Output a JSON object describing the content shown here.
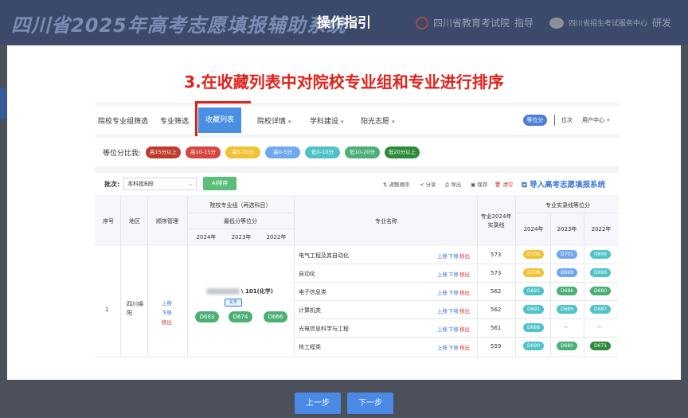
{
  "background": {
    "site_title": "四川省2025年高考志愿填报辅助系统",
    "partner1": "四川省教育考试院",
    "partner1_suffix": "指导",
    "partner2": "四川省招生考试服务中心",
    "partner2_suffix": "研发"
  },
  "modal": {
    "title": "操作指引",
    "step_heading": "3.在收藏列表中对院校专业组和专业进行排序",
    "prev_label": "上一步",
    "next_label": "下一步"
  },
  "nav": {
    "items": [
      "院校专业组筛选",
      "专业筛选",
      "收藏列表",
      "院校详情",
      "学科建设",
      "阳光志愿"
    ],
    "active_index": 2,
    "rank_pill": "等位分",
    "rank_text": "位次",
    "user_center": "用户中心"
  },
  "ratio": {
    "label": "等位分比我:",
    "pills": [
      {
        "text": "高15分以上",
        "color": "#c0392b"
      },
      {
        "text": "高10-15分",
        "color": "#d64541"
      },
      {
        "text": "高5-10分",
        "color": "#f1c232"
      },
      {
        "text": "高0-5分",
        "color": "#6fa8ee"
      },
      {
        "text": "低0-10分",
        "color": "#4fc3c9"
      },
      {
        "text": "低10-20分",
        "color": "#4caf76"
      },
      {
        "text": "低20分以上",
        "color": "#2e8b3a"
      }
    ]
  },
  "toolbar": {
    "batch_label": "批次:",
    "batch_value": "本科批B段",
    "ai_button": "AI排序",
    "tools": [
      "调整顺序",
      "分享",
      "导出",
      "保存",
      "清空"
    ],
    "import_label": "导入高考志愿填报系统"
  },
  "table": {
    "header": {
      "seq": "序号",
      "region": "地区",
      "order_mgmt": "顺序管理",
      "group": "院校专业组（再选科目）",
      "min_rank": "最低分等位分",
      "years": [
        "2024年",
        "2023年",
        "2022年"
      ],
      "major_name": "专业名称",
      "major_line": "专业2024年实录线",
      "major_rank": "专业实录线等位分"
    },
    "row": {
      "seq": "1",
      "region": "四川绵阳",
      "moves": [
        "上移",
        "下移",
        "移出"
      ],
      "group_code": "\\ 101(化学)",
      "subject_tag": "化学",
      "min_ranks": [
        "D683",
        "D674",
        "D666"
      ],
      "majors": [
        {
          "name": "电气工程及其自动化",
          "line": "573",
          "ranks": [
            {
              "t": "D706",
              "c": "#f1c232"
            },
            {
              "t": "D701",
              "c": "#6fa8ee"
            },
            {
              "t": "D696",
              "c": "#4fc3c9"
            }
          ]
        },
        {
          "name": "自动化",
          "line": "573",
          "ranks": [
            {
              "t": "D706",
              "c": "#f1c232"
            },
            {
              "t": "D699",
              "c": "#6fa8ee"
            },
            {
              "t": "D696",
              "c": "#4fc3c9"
            }
          ]
        },
        {
          "name": "电子信息类",
          "line": "562",
          "ranks": [
            {
              "t": "D692",
              "c": "#4fc3c9"
            },
            {
              "t": "D686",
              "c": "#4caf76"
            },
            {
              "t": "D680",
              "c": "#4caf76"
            }
          ]
        },
        {
          "name": "计算机类",
          "line": "562",
          "ranks": [
            {
              "t": "D691",
              "c": "#4fc3c9"
            },
            {
              "t": "D689",
              "c": "#4fc3c9"
            },
            {
              "t": "D687",
              "c": "#4fc3c9"
            }
          ]
        },
        {
          "name": "光电信息科学与工程",
          "line": "561",
          "ranks": [
            {
              "t": "D688",
              "c": "#4fc3c9"
            },
            {
              "t": "--",
              "c": ""
            },
            {
              "t": "--",
              "c": ""
            }
          ]
        },
        {
          "name": "核工程类",
          "line": "559",
          "ranks": [
            {
              "t": "D690",
              "c": "#4fc3c9"
            },
            {
              "t": "D680",
              "c": "#4caf76"
            },
            {
              "t": "D671",
              "c": "#2e8b3a"
            }
          ]
        }
      ],
      "major_moves": [
        "上移",
        "下移",
        "移出"
      ]
    }
  }
}
